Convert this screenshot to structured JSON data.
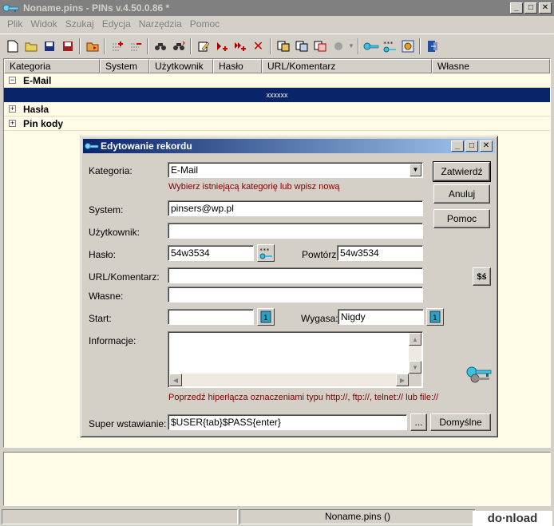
{
  "window": {
    "title": "Noname.pins - PINs v.4.50.0.86 *"
  },
  "menu": [
    "Plik",
    "Widok",
    "Szukaj",
    "Edycja",
    "Narzędzia",
    "Pomoc"
  ],
  "columns": [
    "Kategoria",
    "System",
    "Użytkownik",
    "Hasło",
    "URL/Komentarz",
    "Własne"
  ],
  "tree": {
    "email_label": "E-Mail",
    "email_toggle": "−",
    "selected_row_text": "xxxxxx",
    "hasla_label": "Hasła",
    "hasla_toggle": "+",
    "pin_label": "Pin kody",
    "pin_toggle": "+"
  },
  "statusbar": {
    "file": "Noname.pins ()"
  },
  "watermark": "do∙nload",
  "dialog": {
    "title": "Edytowanie rekordu",
    "kategoria_label": "Kategoria:",
    "kategoria_value": "E-Mail",
    "kategoria_hint": "Wybierz istniejącą kategorię lub wpisz nową",
    "system_label": "System:",
    "system_value": "pinsers@wp.pl",
    "uzytkownik_label": "Użytkownik:",
    "uzytkownik_value": "",
    "haslo_label": "Hasło:",
    "haslo_value": "54w3534",
    "powtorz_label": "Powtórz:",
    "powtorz_value": "54w3534",
    "url_label": "URL/Komentarz:",
    "url_value": "",
    "wlasne_label": "Własne:",
    "wlasne_value": "",
    "start_label": "Start:",
    "start_value": "",
    "wygasa_label": "Wygasa:",
    "wygasa_value": "Nigdy",
    "informacje_label": "Informacje:",
    "hyperlink_hint": "Poprzedź hiperłącza oznaczeniami typu http://, ftp://, telnet:// lub file://",
    "super_label": "Super wstawianie:",
    "super_value": "$USER{tab}$PASS{enter}",
    "ellipsis": "...",
    "btn_confirm": "Zatwierdź",
    "btn_cancel": "Anuluj",
    "btn_help": "Pomoc",
    "btn_default": "Domyślne",
    "currency_button": "$ś"
  }
}
